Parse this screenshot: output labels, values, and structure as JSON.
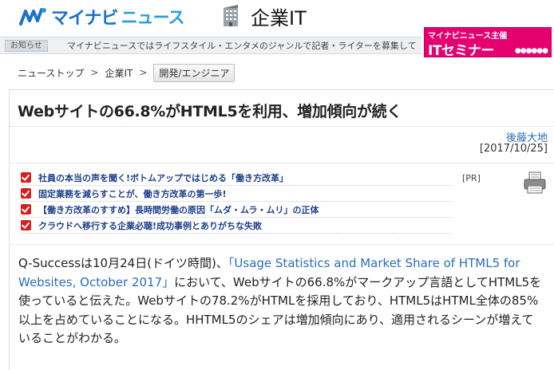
{
  "header": {
    "logo_main": "マイナビ",
    "logo_sub": "ニュース",
    "section_title": "企業IT",
    "logo_icon": "mynavi-logo-icon",
    "section_icon": "building-icon",
    "brand_color": "#1a73c9"
  },
  "notice": {
    "label": "お知らせ",
    "text": "マイナビニュースではライフスタイル・エンタメのジャンルで記者・ライターを募集して"
  },
  "seminar": {
    "top": "マイナビニュース主催",
    "main": "ITセミナー",
    "people": "●●●●●●",
    "color": "#e4006f"
  },
  "breadcrumb": {
    "items": [
      "ニューストップ",
      "企業IT"
    ],
    "separator": ">",
    "current": "開発/エンジニア"
  },
  "article": {
    "title": "Webサイトの66.8%がHTML5を利用、増加傾向が続く",
    "author": "後藤大地",
    "date": "[2017/10/25]",
    "pr_tag": "[PR]",
    "pr_items": [
      "社員の本当の声を聞く!ボトムアップではじめる「働き方改革」",
      "固定業務を減らすことが、働き方改革の第一歩!",
      "【働き方改革のすすめ】長時間労働の原因「ムダ・ムラ・ムリ」の正体",
      "クラウドへ移行する企業必聴!成功事例とありがちな失敗"
    ],
    "body_before_link": "Q-Successは10月24日(ドイツ時間)、",
    "body_link": "「Usage Statistics and Market Share of HTML5 for Websites, October 2017」",
    "body_after_link": "において、Webサイトの66.8%がマークアップ言語としてHTML5を使っていると伝えた。Webサイトの78.2%がHTMLを採用しており、HTML5はHTML全体の85%以上を占めていることになる。HHTML5のシェアは増加傾向にあり、適用されるシーンが増えていることがわかる。"
  }
}
